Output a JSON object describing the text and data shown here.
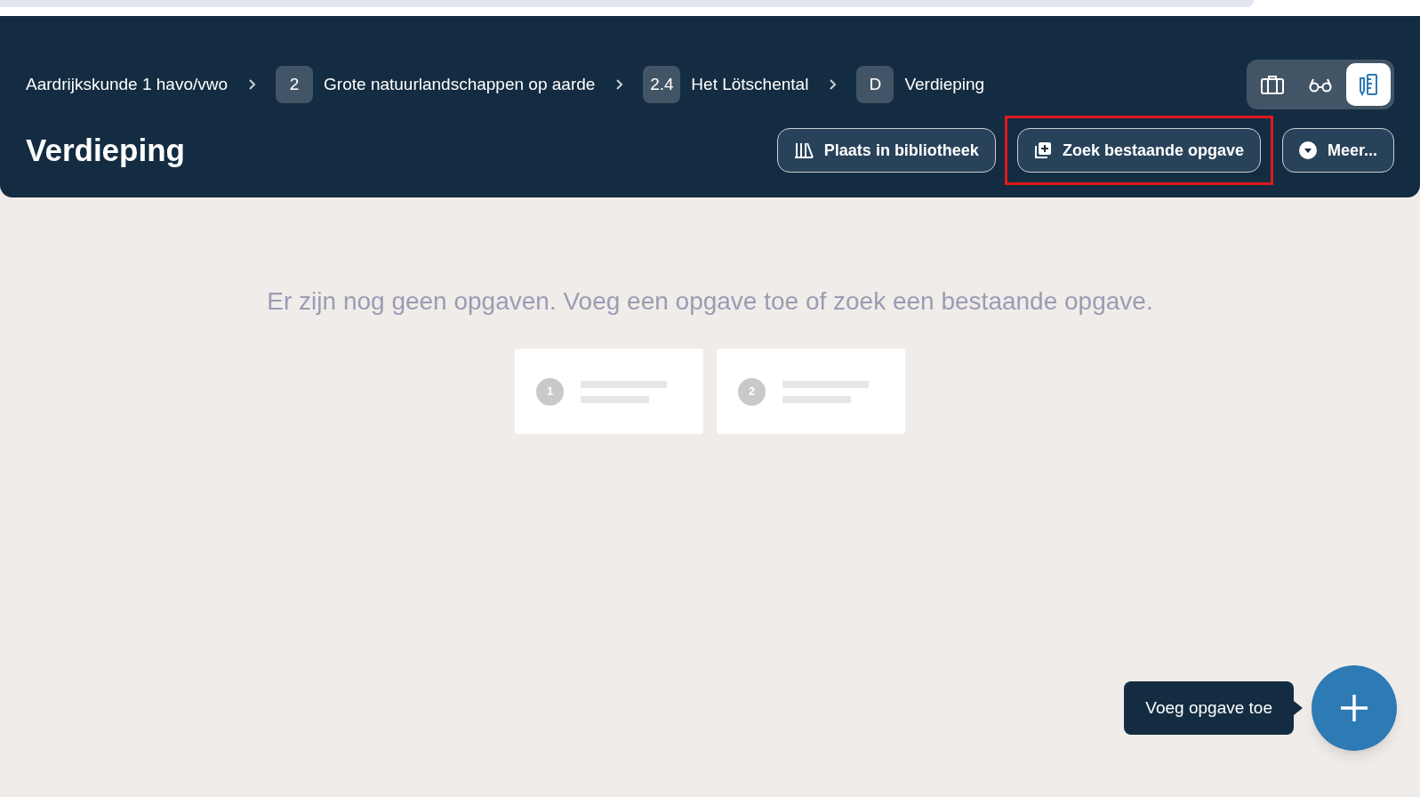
{
  "breadcrumbs": [
    {
      "label": "Aardrijkskunde 1 havo/vwo"
    },
    {
      "badge": "2",
      "label": "Grote natuurlandschappen op aarde"
    },
    {
      "badge": "2.4",
      "label": "Het Lötschental"
    },
    {
      "badge": "D",
      "label": "Verdieping"
    }
  ],
  "view_modes": [
    {
      "kind": "briefcase",
      "selected": false
    },
    {
      "kind": "glasses",
      "selected": false
    },
    {
      "kind": "edit",
      "selected": true
    }
  ],
  "title": "Verdieping",
  "actions": [
    {
      "kind": "library",
      "label": "Plaats in bibliotheek",
      "highlighted": false
    },
    {
      "kind": "find",
      "label": "Zoek bestaande opgave",
      "highlighted": true
    },
    {
      "kind": "more",
      "label": "Meer...",
      "highlighted": false
    }
  ],
  "empty_message": "Er zijn nog geen opgaven. Voeg een opgave toe of zoek een bestaande opgave.",
  "placeholder_cards": [
    {
      "number": "1"
    },
    {
      "number": "2"
    }
  ],
  "add_tooltip": "Voeg opgave toe"
}
